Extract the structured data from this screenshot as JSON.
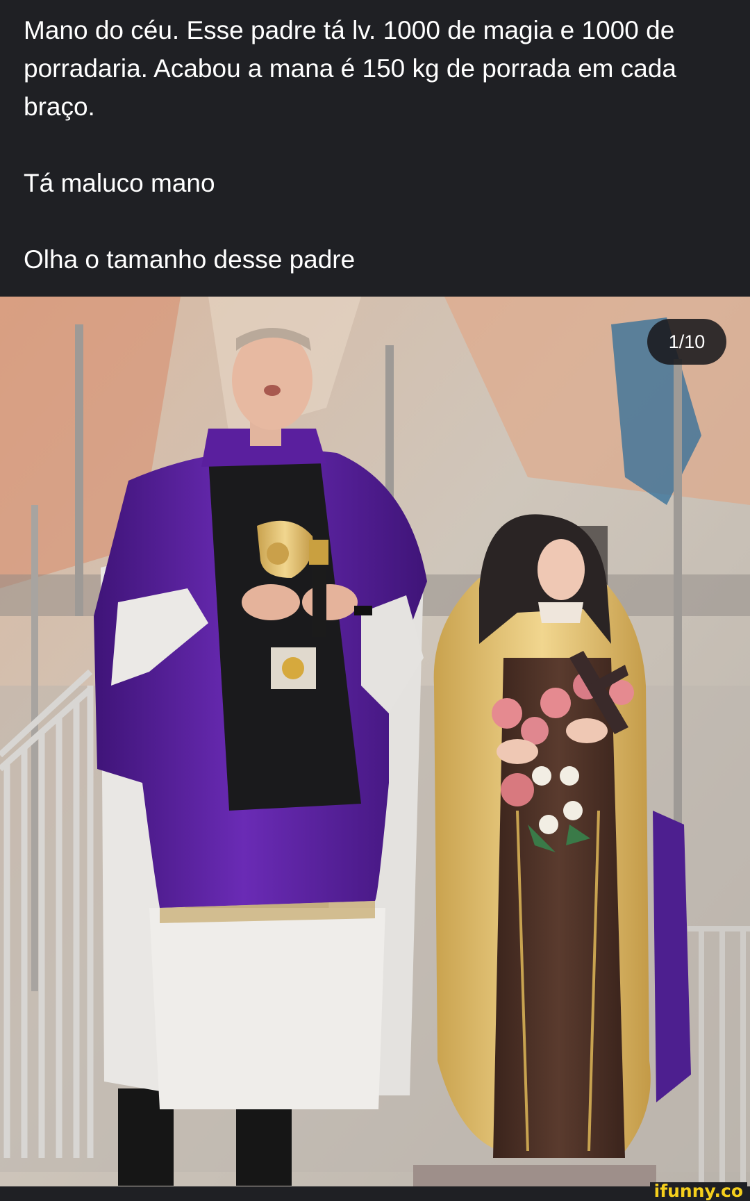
{
  "post": {
    "paragraphs": [
      "Mano do céu. Esse padre tá lv. 1000 de magia e 1000 de porradaria. Acabou a mana é 150 kg de porrada em cada braço.",
      "Tá maluco mano",
      "Olha o tamanho desse padre"
    ]
  },
  "media": {
    "counter": "1/10",
    "colors": {
      "vestment_purple": "#5a1f9e",
      "stole_black": "#1a1a1c",
      "statue_gold": "#e8c56e",
      "statue_brown": "#4a3026",
      "rose_pink": "#e58a90"
    }
  },
  "watermark": {
    "text": "ifunny.co"
  }
}
